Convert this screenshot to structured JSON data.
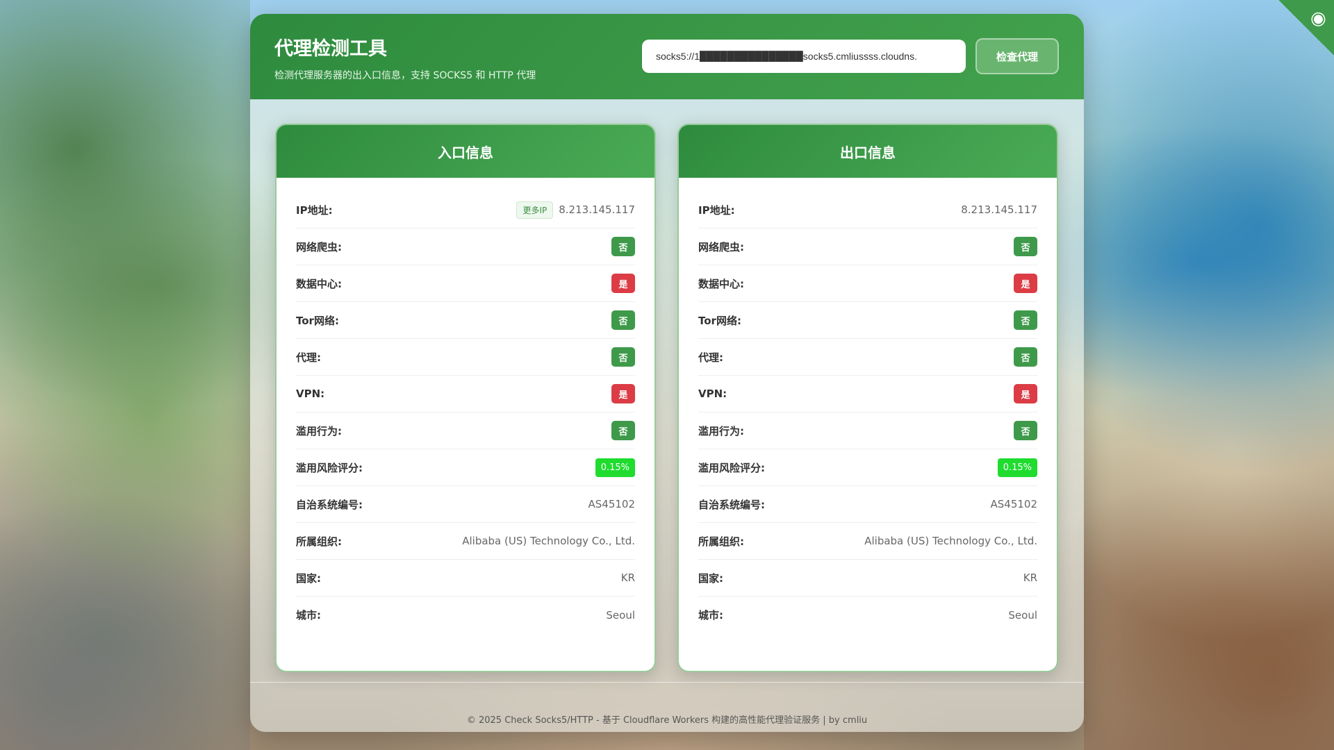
{
  "header": {
    "title": "代理检测工具",
    "subtitle": "检测代理服务器的出入口信息，支持 SOCKS5 和 HTTP 代理",
    "proxy_input_value": "socks5://1███████████████socks5.cmliussss.cloudns.",
    "check_button": "检查代理"
  },
  "entry": {
    "title": "入口信息",
    "more_ip_label": "更多IP",
    "rows": [
      {
        "label": "IP地址:",
        "value": "8.213.145.117"
      },
      {
        "label": "网络爬虫:",
        "value": "否"
      },
      {
        "label": "数据中心:",
        "value": "是"
      },
      {
        "label": "Tor网络:",
        "value": "否"
      },
      {
        "label": "代理:",
        "value": "否"
      },
      {
        "label": "VPN:",
        "value": "是"
      },
      {
        "label": "滥用行为:",
        "value": "否"
      },
      {
        "label": "滥用风险评分:",
        "value": "0.15%"
      },
      {
        "label": "自治系统编号:",
        "value": "AS45102"
      },
      {
        "label": "所属组织:",
        "value": "Alibaba (US) Technology Co., Ltd."
      },
      {
        "label": "国家:",
        "value": "KR"
      },
      {
        "label": "城市:",
        "value": "Seoul"
      }
    ]
  },
  "exit": {
    "title": "出口信息",
    "rows": [
      {
        "label": "IP地址:",
        "value": "8.213.145.117"
      },
      {
        "label": "网络爬虫:",
        "value": "否"
      },
      {
        "label": "数据中心:",
        "value": "是"
      },
      {
        "label": "Tor网络:",
        "value": "否"
      },
      {
        "label": "代理:",
        "value": "否"
      },
      {
        "label": "VPN:",
        "value": "是"
      },
      {
        "label": "滥用行为:",
        "value": "否"
      },
      {
        "label": "滥用风险评分:",
        "value": "0.15%"
      },
      {
        "label": "自治系统编号:",
        "value": "AS45102"
      },
      {
        "label": "所属组织:",
        "value": "Alibaba (US) Technology Co., Ltd."
      },
      {
        "label": "国家:",
        "value": "KR"
      },
      {
        "label": "城市:",
        "value": "Seoul"
      }
    ]
  },
  "footer": "© 2025 Check Socks5/HTTP - 基于 Cloudflare Workers 构建的高性能代理验证服务 | by cmliu",
  "colors": {
    "primary": "#2e8b3e",
    "yes": "#dc3c45",
    "no": "#3e9a4a",
    "score": "#1fdc2f"
  },
  "icons": {
    "corner": "github-icon"
  }
}
